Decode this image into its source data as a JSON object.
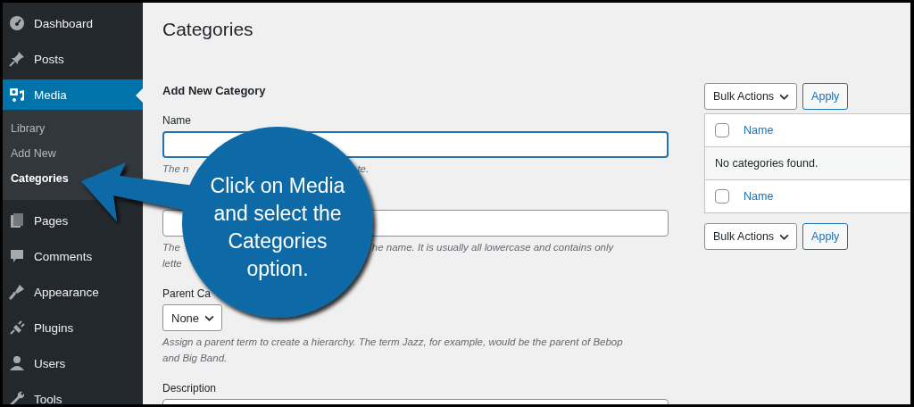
{
  "sidebar": {
    "items": [
      {
        "label": "Dashboard",
        "selected": false
      },
      {
        "label": "Posts",
        "selected": false
      },
      {
        "label": "Media",
        "selected": true,
        "children": [
          {
            "label": "Library",
            "selected": false
          },
          {
            "label": "Add New",
            "selected": false
          },
          {
            "label": "Categories",
            "selected": true
          }
        ]
      },
      {
        "label": "Pages",
        "selected": false
      },
      {
        "label": "Comments",
        "selected": false
      },
      {
        "label": "Appearance",
        "selected": false
      },
      {
        "label": "Plugins",
        "selected": false
      },
      {
        "label": "Users",
        "selected": false
      },
      {
        "label": "Tools",
        "selected": false
      }
    ]
  },
  "page_title": "Categories",
  "form": {
    "heading": "Add New Category",
    "fields": [
      {
        "kind": "text",
        "label": "Name",
        "focused": true,
        "help": [
          [
            "The n",
            "te."
          ]
        ]
      },
      {
        "kind": "text",
        "help": [
          [
            "The",
            "he name. It is usually all lowercase and contains only"
          ],
          [
            "lette"
          ]
        ]
      },
      {
        "kind": "select",
        "label": "Parent Ca",
        "value": "None",
        "help": [
          [
            "Assign a parent term to create a hierarchy. The term Jazz, for example, would be the parent of Bebop"
          ],
          [
            "and Big Band."
          ]
        ]
      },
      {
        "kind": "textarea",
        "label": "Description"
      }
    ]
  },
  "list": {
    "bulk_top": {
      "select": "Bulk Actions",
      "button": "Apply"
    },
    "header": {
      "checked": false,
      "column": "Name"
    },
    "empty_message": "No categories found.",
    "footer": {
      "checked": false,
      "column": "Name"
    },
    "bulk_bottom": {
      "select": "Bulk Actions",
      "button": "Apply"
    }
  },
  "callout": {
    "text": "Click on Media and select the Categories option."
  }
}
